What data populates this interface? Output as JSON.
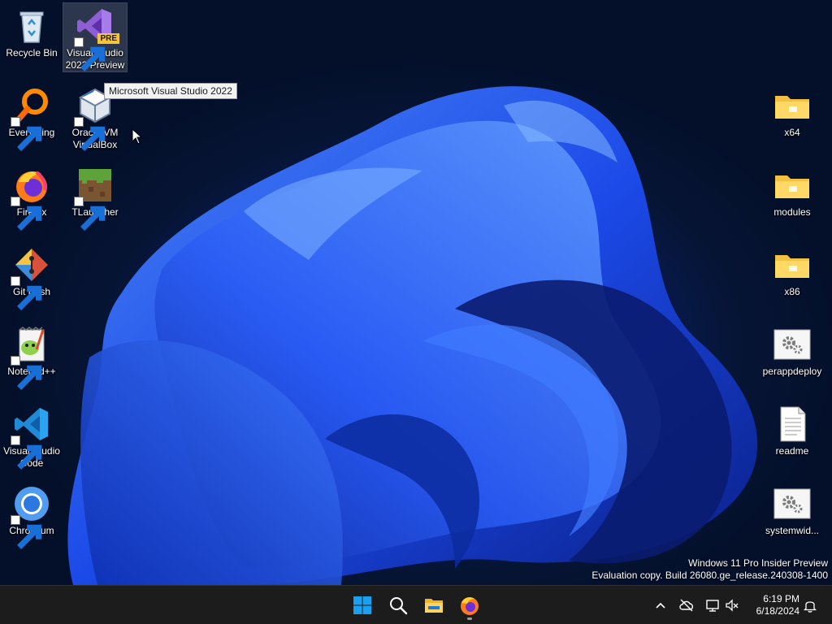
{
  "desktop": {
    "left_icons": [
      {
        "label": "Recycle Bin",
        "icon": "recycle-bin-icon"
      },
      {
        "label": "Everything",
        "icon": "everything-search-icon"
      },
      {
        "label": "Firefox",
        "icon": "firefox-icon"
      },
      {
        "label": "Git Bash",
        "icon": "git-bash-icon"
      },
      {
        "label": "Notepad++",
        "icon": "notepad-plus-plus-icon"
      },
      {
        "label": "Visual Studio Code",
        "line1": "Visual Studio",
        "line2": "Code",
        "icon": "vscode-icon"
      },
      {
        "label": "Chromium",
        "icon": "chromium-icon"
      }
    ],
    "second_column_icons": [
      {
        "label": "Visual Studio 2022 Preview",
        "line1": "Visual Studio",
        "line2": "2022 Preview",
        "badge": "PRE",
        "icon": "visual-studio-preview-icon",
        "selected": true
      },
      {
        "label": "Oracle VM VirtualBox",
        "line1": "Oracle VM",
        "line2": "VirtualBox",
        "icon": "virtualbox-icon"
      },
      {
        "label": "TLauncher",
        "icon": "tlauncher-icon"
      }
    ],
    "right_icons": [
      {
        "label": "x64",
        "icon": "folder-icon"
      },
      {
        "label": "modules",
        "icon": "folder-icon"
      },
      {
        "label": "x86",
        "icon": "folder-icon"
      },
      {
        "label": "perappdeploy",
        "icon": "settings-file-icon"
      },
      {
        "label": "readme",
        "icon": "text-document-icon"
      },
      {
        "label": "systemwid...",
        "icon": "settings-file-icon"
      }
    ],
    "tooltip": "Microsoft Visual Studio 2022",
    "watermark": {
      "line1": "Windows 11 Pro Insider Preview",
      "line2": "Evaluation copy. Build 26080.ge_release.240308-1400"
    }
  },
  "taskbar": {
    "pinned": [
      {
        "name": "start",
        "icon": "windows-start-icon"
      },
      {
        "name": "search",
        "icon": "search-icon"
      },
      {
        "name": "file-explorer",
        "icon": "file-explorer-icon"
      },
      {
        "name": "firefox",
        "icon": "firefox-icon",
        "running": true
      }
    ],
    "tray": [
      {
        "name": "show-hidden-icons",
        "icon": "chevron-up-icon"
      },
      {
        "name": "onedrive",
        "icon": "cloud-offline-icon"
      },
      {
        "name": "network",
        "icon": "network-icon"
      },
      {
        "name": "volume",
        "icon": "volume-muted-icon"
      }
    ],
    "clock": {
      "time": "6:19 PM",
      "date": "6/18/2024"
    },
    "notifications": {
      "icon": "bell-icon"
    }
  },
  "colors": {
    "taskbar": "#1c1c1c",
    "bloom_blue": "#1f4fff",
    "folder_yellow": "#f3c043",
    "windows_blue": "#1aa0f0"
  }
}
